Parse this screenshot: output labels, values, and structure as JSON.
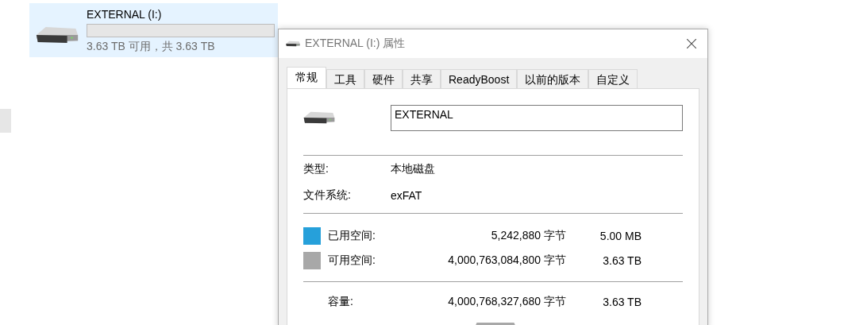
{
  "drive_tile": {
    "name": "EXTERNAL  (I:)",
    "level": 0,
    "summary": "3.63 TB 可用，共 3.63 TB",
    "selected": true
  },
  "dialog": {
    "title": "EXTERNAL  (I:) 属性",
    "tabs": [
      {
        "label": "常规",
        "selected": true
      },
      {
        "label": "工具",
        "selected": false
      },
      {
        "label": "硬件",
        "selected": false
      },
      {
        "label": "共享",
        "selected": false
      },
      {
        "label": "ReadyBoost",
        "selected": false
      },
      {
        "label": "以前的版本",
        "selected": false
      },
      {
        "label": "自定义",
        "selected": false
      }
    ],
    "name_field": {
      "value": "EXTERNAL"
    },
    "info": [
      {
        "label": "类型:",
        "value": "本地磁盘"
      },
      {
        "label": "文件系统:",
        "value": "exFAT"
      }
    ],
    "space": [
      {
        "label": "已用空间:",
        "bytes": "5,242,880 字节",
        "size": "5.00 MB",
        "color": "#26a0da"
      },
      {
        "label": "可用空间:",
        "bytes": "4,000,763,084,800 字节",
        "size": "3.63 TB",
        "color": "#a8a8a8"
      }
    ],
    "capacity": {
      "label": "容量:",
      "bytes": "4,000,768,327,680 字节",
      "size": "3.63 TB"
    }
  }
}
